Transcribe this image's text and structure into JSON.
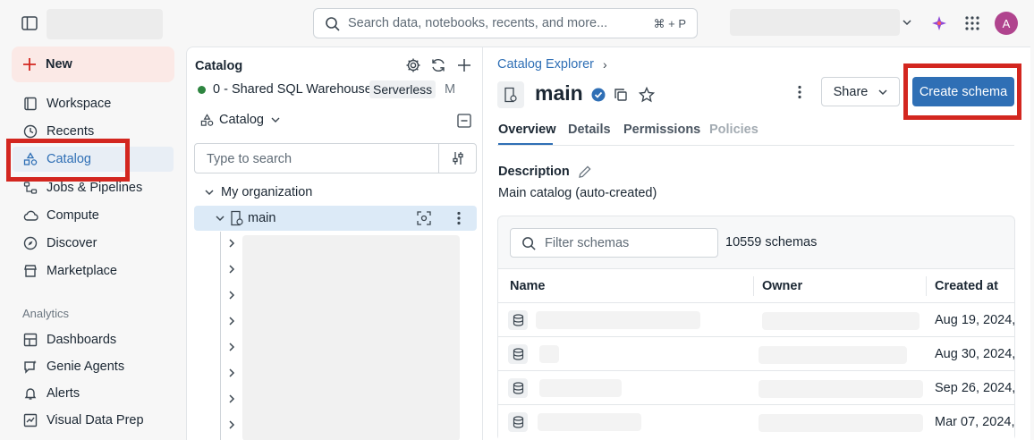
{
  "topbar": {
    "search_placeholder": "Search data, notebooks, recents, and more...",
    "search_shortcut": "⌘ + P",
    "avatar_letter": "A"
  },
  "sidebar": {
    "new_label": "New",
    "items": [
      {
        "label": "Workspace",
        "icon": "workspace-icon"
      },
      {
        "label": "Recents",
        "icon": "clock-icon"
      },
      {
        "label": "Catalog",
        "icon": "catalog-icon",
        "active": true
      },
      {
        "label": "Jobs & Pipelines",
        "icon": "jobs-icon"
      },
      {
        "label": "Compute",
        "icon": "cloud-icon"
      },
      {
        "label": "Discover",
        "icon": "compass-icon"
      },
      {
        "label": "Marketplace",
        "icon": "store-icon"
      }
    ],
    "section_analytics": "Analytics",
    "analytics_items": [
      {
        "label": "Dashboards",
        "icon": "dashboard-icon"
      },
      {
        "label": "Genie Agents",
        "icon": "genie-icon"
      },
      {
        "label": "Alerts",
        "icon": "bell-icon"
      },
      {
        "label": "Visual Data Prep",
        "icon": "dataprep-icon"
      }
    ]
  },
  "catalog_panel": {
    "title": "Catalog",
    "warehouse_name": "0 - Shared SQL Warehouse",
    "warehouse_badge": "Serverless",
    "warehouse_size": "M",
    "warehouse_status_color": "#2e8540",
    "scope_label": "Catalog",
    "search_placeholder": "Type to search",
    "org_label": "My organization",
    "selected_node": "main"
  },
  "main": {
    "breadcrumb": "Catalog Explorer",
    "breadcrumb_sep": "›",
    "title": "main",
    "share_label": "Share",
    "create_schema_label": "Create schema",
    "tabs": [
      {
        "label": "Overview",
        "active": true
      },
      {
        "label": "Details"
      },
      {
        "label": "Permissions"
      },
      {
        "label": "Policies",
        "disabled": true
      }
    ],
    "description_label": "Description",
    "description_text": "Main catalog (auto-created)",
    "filter_placeholder": "Filter schemas",
    "schema_count": "10559 schemas",
    "table": {
      "columns": [
        "Name",
        "Owner",
        "Created at"
      ],
      "rows": [
        {
          "created": "Aug 19, 2024,"
        },
        {
          "created": "Aug 30, 2024,"
        },
        {
          "created": "Sep 26, 2024,"
        },
        {
          "created": "Mar 07, 2024,"
        }
      ]
    }
  },
  "colors": {
    "accent_blue": "#2f6fb5",
    "highlight_red": "#d3261f",
    "new_button_bg": "#fbe9e6",
    "avatar_bg": "#b0448e"
  }
}
